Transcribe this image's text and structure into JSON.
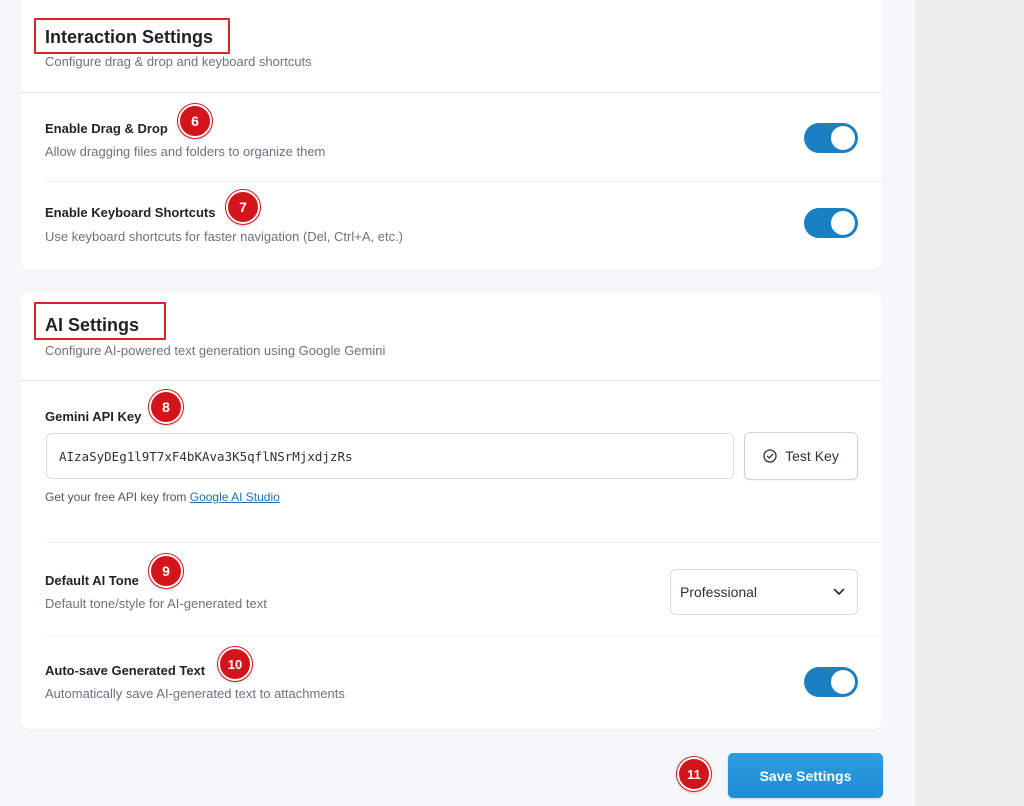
{
  "interaction": {
    "title": "Interaction Settings",
    "description": "Configure drag & drop and keyboard shortcuts",
    "drag_drop": {
      "title": "Enable Drag & Drop",
      "description": "Allow dragging files and folders to organize them",
      "enabled": true,
      "badge": "6"
    },
    "shortcuts": {
      "title": "Enable Keyboard Shortcuts",
      "description": "Use keyboard shortcuts for faster navigation (Del, Ctrl+A, etc.)",
      "enabled": true,
      "badge": "7"
    }
  },
  "ai": {
    "title": "AI Settings",
    "description": "Configure AI-powered text generation using Google Gemini",
    "api_key": {
      "label": "Gemini API Key",
      "value": "AIzaSyDEg1l9T7xF4bKAva3K5qflNSrMjxdjzRs",
      "badge": "8",
      "test_button": "Test Key",
      "help_prefix": "Get your free API key from",
      "help_link": "Google AI Studio"
    },
    "tone": {
      "title": "Default AI Tone",
      "description": "Default tone/style for AI-generated text",
      "selected": "Professional",
      "badge": "9"
    },
    "autosave": {
      "title": "Auto-save Generated Text",
      "description": "Automatically save AI-generated text to attachments",
      "enabled": true,
      "badge": "10"
    }
  },
  "footer": {
    "save_label": "Save Settings",
    "badge": "11"
  },
  "colors": {
    "accent": "#1a80c4",
    "badge": "#d4141b",
    "highlight_box": "#d6262b"
  },
  "icons": {
    "test_key": "check-circle-icon",
    "select": "chevron-down-icon"
  }
}
